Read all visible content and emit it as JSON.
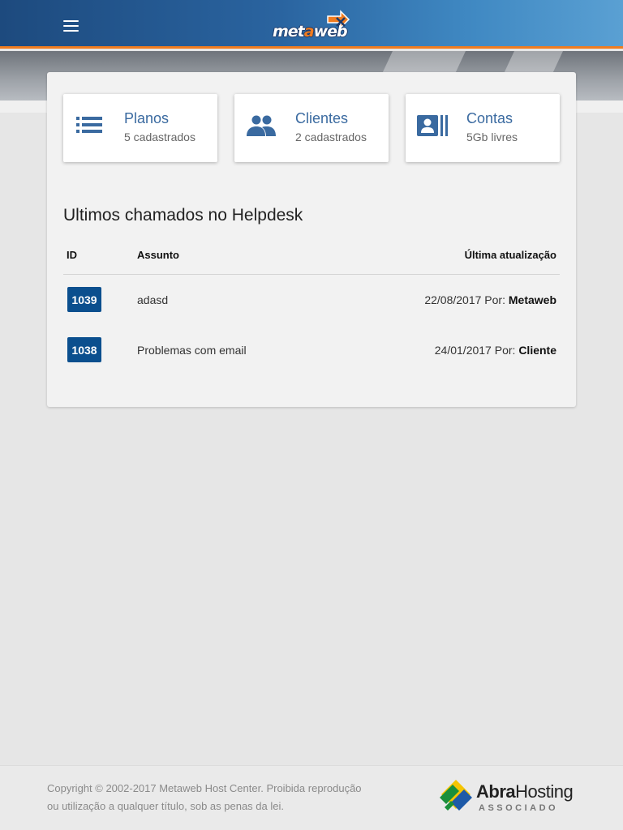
{
  "header": {
    "menu_icon": "hamburger-menu-icon",
    "logo_text_pre": "met",
    "logo_text_o": "a",
    "logo_text_post": "web"
  },
  "stats": [
    {
      "title": "Planos",
      "subtitle": "5 cadastrados",
      "icon": "list-icon"
    },
    {
      "title": "Clientes",
      "subtitle": "2 cadastrados",
      "icon": "people-icon"
    },
    {
      "title": "Contas",
      "subtitle": "5Gb livres",
      "icon": "contact-card-icon"
    }
  ],
  "helpdesk": {
    "title": "Ultimos chamados no Helpdesk",
    "columns": {
      "id": "ID",
      "subject": "Assunto",
      "updated": "Última atualização"
    },
    "rows": [
      {
        "id": "1039",
        "subject": "adasd",
        "date": "22/08/2017",
        "by_label": "Por:",
        "by": "Metaweb"
      },
      {
        "id": "1038",
        "subject": "Problemas com email",
        "date": "24/01/2017",
        "by_label": "Por:",
        "by": "Cliente"
      }
    ]
  },
  "footer": {
    "copyright_line1": "Copyright © 2002-2017 Metaweb Host Center. Proibida reprodução",
    "copyright_line2": "ou utilização a qualquer título, sob as penas da lei.",
    "partner_brand_bold": "Abra",
    "partner_brand_rest": "Hosting",
    "partner_tag": "ASSOCIADO"
  },
  "colors": {
    "accent_blue": "#3a6aa0",
    "badge_blue": "#0b4f8e",
    "header_orange": "#f07c20"
  }
}
